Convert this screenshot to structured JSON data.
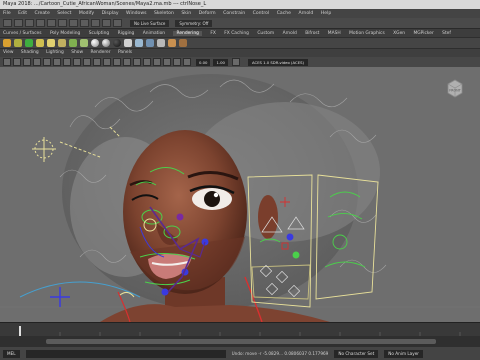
{
  "window": {
    "title": "Maya 2018: .../Cartoon_Cutie_AfricanWoman/Scenes/Maya2.ma.mb --- ctrlNose_L"
  },
  "menubar": {
    "items": [
      "File",
      "Edit",
      "Create",
      "Select",
      "Modify",
      "Display",
      "Windows",
      "Skeleton",
      "Skin",
      "Deform",
      "Constrain",
      "Control",
      "Cache",
      "Arnold",
      "Help"
    ]
  },
  "statusline": {
    "surface_field": "No Live Surface",
    "symmetry_field": "Symmetry: Off"
  },
  "shelf_tabs": {
    "items": [
      "Curves / Surfaces",
      "Poly Modeling",
      "Sculpting",
      "Rigging",
      "Animation",
      "Rendering",
      "FX",
      "FX Caching",
      "Custom",
      "Arnold",
      "Bifrost",
      "MASH",
      "Motion Graphics",
      "XGen",
      "MGPicker",
      "Stef"
    ],
    "active": "Rendering"
  },
  "viewport": {
    "menu": [
      "View",
      "Shading",
      "Lighting",
      "Show",
      "Renderer",
      "Panels"
    ],
    "camera_near": "0.00",
    "camera_far": "1.00",
    "colorspace": "ACES 1.0 SDR-video (ACES)",
    "viewcube_label": "FRONT"
  },
  "colors": {
    "skin": "#8a4a34",
    "skin_dark": "#5a2c20",
    "rig_green": "#4bd04b",
    "rig_blue": "#3a3ae0",
    "rig_yellow": "#e8e09a",
    "rig_purple": "#7a2aa0",
    "hair": "#9a9a9a"
  },
  "statusbar": {
    "mel_label": "MEL",
    "undo_text": "Undo: move -r -5.0829... 0.0806037 0.177969",
    "character_set": "No Character Set",
    "anim_layer": "No Anim Layer"
  }
}
